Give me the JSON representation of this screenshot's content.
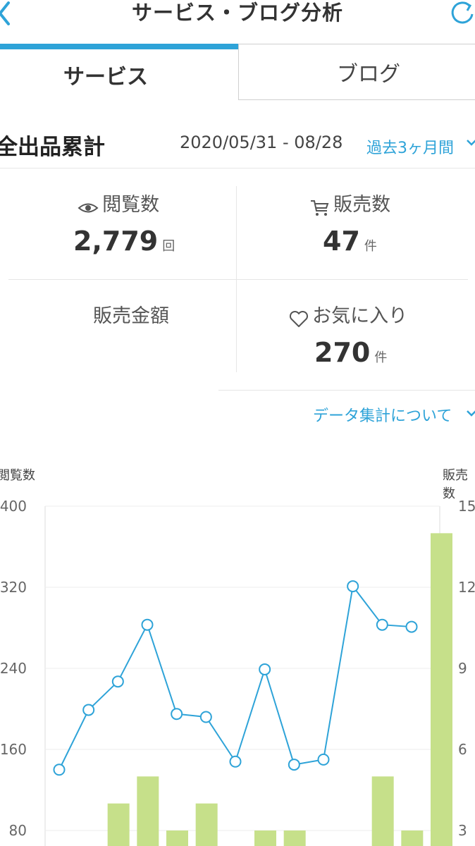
{
  "header": {
    "title": "サービス・ブログ分析"
  },
  "tabs": [
    {
      "label": "サービス",
      "active": true
    },
    {
      "label": "ブログ",
      "active": false
    }
  ],
  "summary": {
    "title": "全出品累計",
    "date_range": "2020/05/31 - 08/28",
    "period": "過去3ヶ月間"
  },
  "stats": {
    "views": {
      "label": "閲覧数",
      "value": "2,779",
      "unit": "回"
    },
    "sales": {
      "label": "販売数",
      "value": "47",
      "unit": "件"
    },
    "revenue": {
      "label": "販売金額"
    },
    "favorites": {
      "label": "お気に入り",
      "value": "270",
      "unit": "件"
    }
  },
  "about_link": "データ集計について",
  "colors": {
    "accent": "#2ea3d8",
    "bar": "#c6e08a",
    "line": "#2ea3d8"
  },
  "chart_data": {
    "type": "bar",
    "y_left_label": "閲覧数",
    "y_right_label": "販売数",
    "y_left_ticks": [
      "80",
      "160",
      "240",
      "320",
      "400"
    ],
    "y_right_ticks": [
      "3",
      "6",
      "9",
      "12",
      "15"
    ],
    "ylim_left": [
      0,
      400
    ],
    "ylim_right": [
      0,
      15
    ],
    "series": [
      {
        "name": "閲覧数",
        "type": "line",
        "axis": "left",
        "values": [
          140,
          199,
          227,
          283,
          195,
          192,
          148,
          239,
          145,
          150,
          321,
          283,
          281
        ]
      },
      {
        "name": "販売数",
        "type": "bar",
        "axis": "right",
        "values": [
          0,
          4,
          5,
          3,
          4,
          0,
          3,
          3,
          0,
          0,
          5,
          3,
          14
        ]
      }
    ]
  }
}
